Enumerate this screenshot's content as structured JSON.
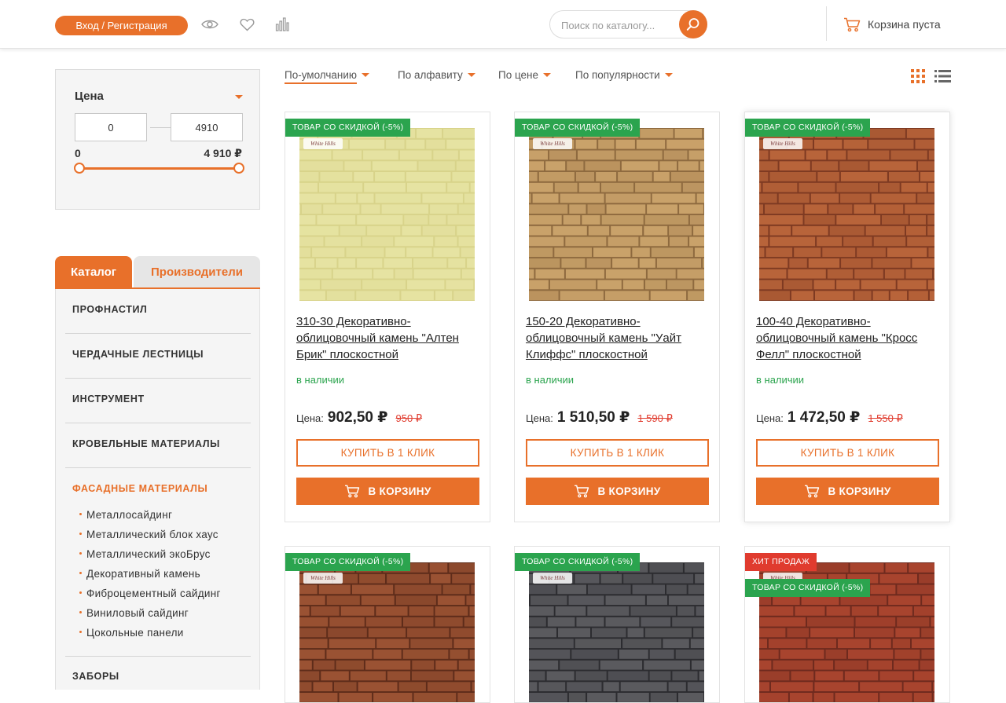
{
  "header": {
    "login_label": "Вход / Регистрация",
    "search_placeholder": "Поиск по каталогу...",
    "cart_label": "Корзина пуста",
    "icons": [
      "eye-icon",
      "heart-icon",
      "compare-icon",
      "search-icon",
      "cart-icon"
    ]
  },
  "filter": {
    "title": "Цена",
    "min_input": "0",
    "max_input": "4910",
    "min_label": "0",
    "max_label": "4 910 ₽",
    "range_selected": [
      0,
      1
    ]
  },
  "catalog": {
    "tabs": [
      "Каталог",
      "Производители"
    ],
    "items": [
      "Профнастил",
      "Чердачные лестницы",
      "Инструмент",
      "Кровельные материалы",
      "Фасадные материалы",
      "Заборы"
    ],
    "active": "Фасадные материалы",
    "sub_items": [
      "Металлосайдинг",
      "Металлический блок хаус",
      "Металлический экоБрус",
      "Декоративный камень",
      "Фиброцементный сайдинг",
      "Виниловый сайдинг",
      "Цокольные панели"
    ]
  },
  "sort": {
    "options": [
      "По-умолчанию",
      "По алфавиту",
      "По цене",
      "По популярности"
    ],
    "active": "По-умолчанию"
  },
  "products": [
    {
      "badges": [
        "ТОВАР СО СКИДКОЙ (-5%)"
      ],
      "title": "310-30 Декоративно-облицовочный камень \"Алтен Брик\" плоскостной",
      "stock": "в наличии",
      "price_label": "Цена:",
      "price": "902,50 ₽",
      "old_price": "950 ₽",
      "btn_1click": "Купить в 1 клик",
      "btn_cart": "В корзину",
      "image_colors": [
        "#e6e3a2",
        "#d8d38a"
      ]
    },
    {
      "badges": [
        "ТОВАР СО СКИДКОЙ (-5%)"
      ],
      "title": "150-20 Декоративно-облицовочный камень \"Уайт Клиффс\" плоскостной",
      "stock": "в наличии",
      "price_label": "Цена:",
      "price": "1 510,50 ₽",
      "old_price": "1 590 ₽",
      "btn_1click": "Купить в 1 клик",
      "btn_cart": "В корзину",
      "image_colors": [
        "#c9a26a",
        "#8e6a3f"
      ]
    },
    {
      "badges": [
        "ТОВАР СО СКИДКОЙ (-5%)"
      ],
      "title": "100-40 Декоративно-облицовочный камень \"Кросс Фелл\" плоскостной",
      "stock": "в наличии",
      "price_label": "Цена:",
      "price": "1 472,50 ₽",
      "old_price": "1 550 ₽",
      "btn_1click": "Купить в 1 клик",
      "btn_cart": "В корзину",
      "image_colors": [
        "#b8643a",
        "#7e3a22"
      ]
    },
    {
      "badges": [
        "ТОВАР СО СКИДКОЙ (-5%)"
      ],
      "title": "",
      "image_colors": [
        "#9a5233",
        "#5e2c1a"
      ]
    },
    {
      "badges": [
        "ТОВАР СО СКИДКОЙ (-5%)"
      ],
      "title": "",
      "image_colors": [
        "#5a5a5e",
        "#2c2c30"
      ]
    },
    {
      "badges": [
        "ХИТ ПРОДАЖ",
        "ТОВАР СО СКИДКОЙ (-5%)"
      ],
      "title": "",
      "image_colors": [
        "#a8442e",
        "#6e2a1e"
      ]
    }
  ],
  "image_logo": "White Hills",
  "colors": {
    "accent": "#e8702a",
    "badge_green": "#2ba44e",
    "badge_red": "#e03b2e",
    "stock_green": "#2ba44e"
  }
}
